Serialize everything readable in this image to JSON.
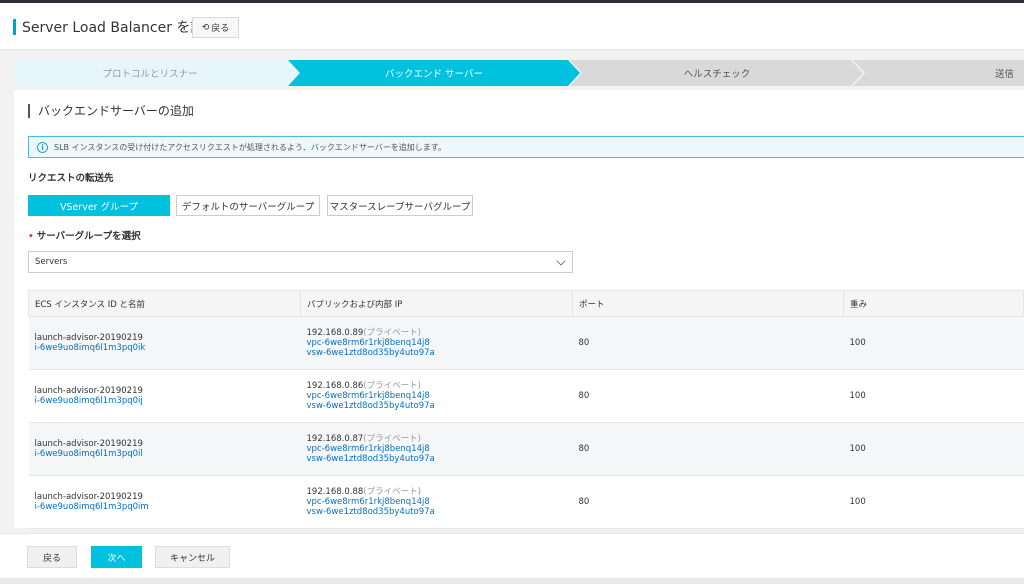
{
  "header": {
    "title": "Server Load Balancer を設定",
    "back_label": "戻る",
    "back_icon": "undo-icon"
  },
  "steps": [
    {
      "label": "プロトコルとリスナー",
      "state": "done"
    },
    {
      "label": "バックエンド サーバー",
      "state": "active"
    },
    {
      "label": "ヘルスチェック",
      "state": "pending"
    },
    {
      "label": "送信",
      "state": "pending"
    }
  ],
  "section": {
    "title": "バックエンドサーバーの追加",
    "info": "SLB インスタンスの受け付けたアクセスリクエストが処理されるよう、バックエンドサーバーを追加します。"
  },
  "forward": {
    "label": "リクエストの転送先",
    "options": [
      "VServer グループ",
      "デフォルトのサーバーグループ",
      "マスタースレーブサーバグループ"
    ],
    "selected": "VServer グループ"
  },
  "group_select": {
    "label": "サーバーグループを選択",
    "value": "Servers"
  },
  "table": {
    "columns": [
      "ECS インスタンス ID と名前",
      "パブリックおよび内部 IP",
      "ポート",
      "重み"
    ],
    "rows": [
      {
        "name": "launch-advisor-20190219",
        "id": "i-6we9uo8imq6l1m3pq0ik",
        "ip": "192.168.0.89",
        "ip_type": "(プライベート)",
        "vpc": "vpc-6we8rm6r1rkj8benq14j8",
        "vsw": "vsw-6we1ztd8od35by4uto97a",
        "port": "80",
        "weight": "100"
      },
      {
        "name": "launch-advisor-20190219",
        "id": "i-6we9uo8imq6l1m3pq0ij",
        "ip": "192.168.0.86",
        "ip_type": "(プライベート)",
        "vpc": "vpc-6we8rm6r1rkj8benq14j8",
        "vsw": "vsw-6we1ztd8od35by4uto97a",
        "port": "80",
        "weight": "100"
      },
      {
        "name": "launch-advisor-20190219",
        "id": "i-6we9uo8imq6l1m3pq0il",
        "ip": "192.168.0.87",
        "ip_type": "(プライベート)",
        "vpc": "vpc-6we8rm6r1rkj8benq14j8",
        "vsw": "vsw-6we1ztd8od35by4uto97a",
        "port": "80",
        "weight": "100"
      },
      {
        "name": "launch-advisor-20190219",
        "id": "i-6we9uo8imq6l1m3pq0im",
        "ip": "192.168.0.88",
        "ip_type": "(プライベート)",
        "vpc": "vpc-6we8rm6r1rkj8benq14j8",
        "vsw": "vsw-6we1ztd8od35by4uto97a",
        "port": "80",
        "weight": "100"
      }
    ]
  },
  "footer": {
    "back": "戻る",
    "next": "次へ",
    "cancel": "キャンセル"
  },
  "colors": {
    "accent": "#00c1de",
    "step_done": "#e6f6fb",
    "step_pending": "#d9d9d9",
    "link": "#0070cc"
  }
}
